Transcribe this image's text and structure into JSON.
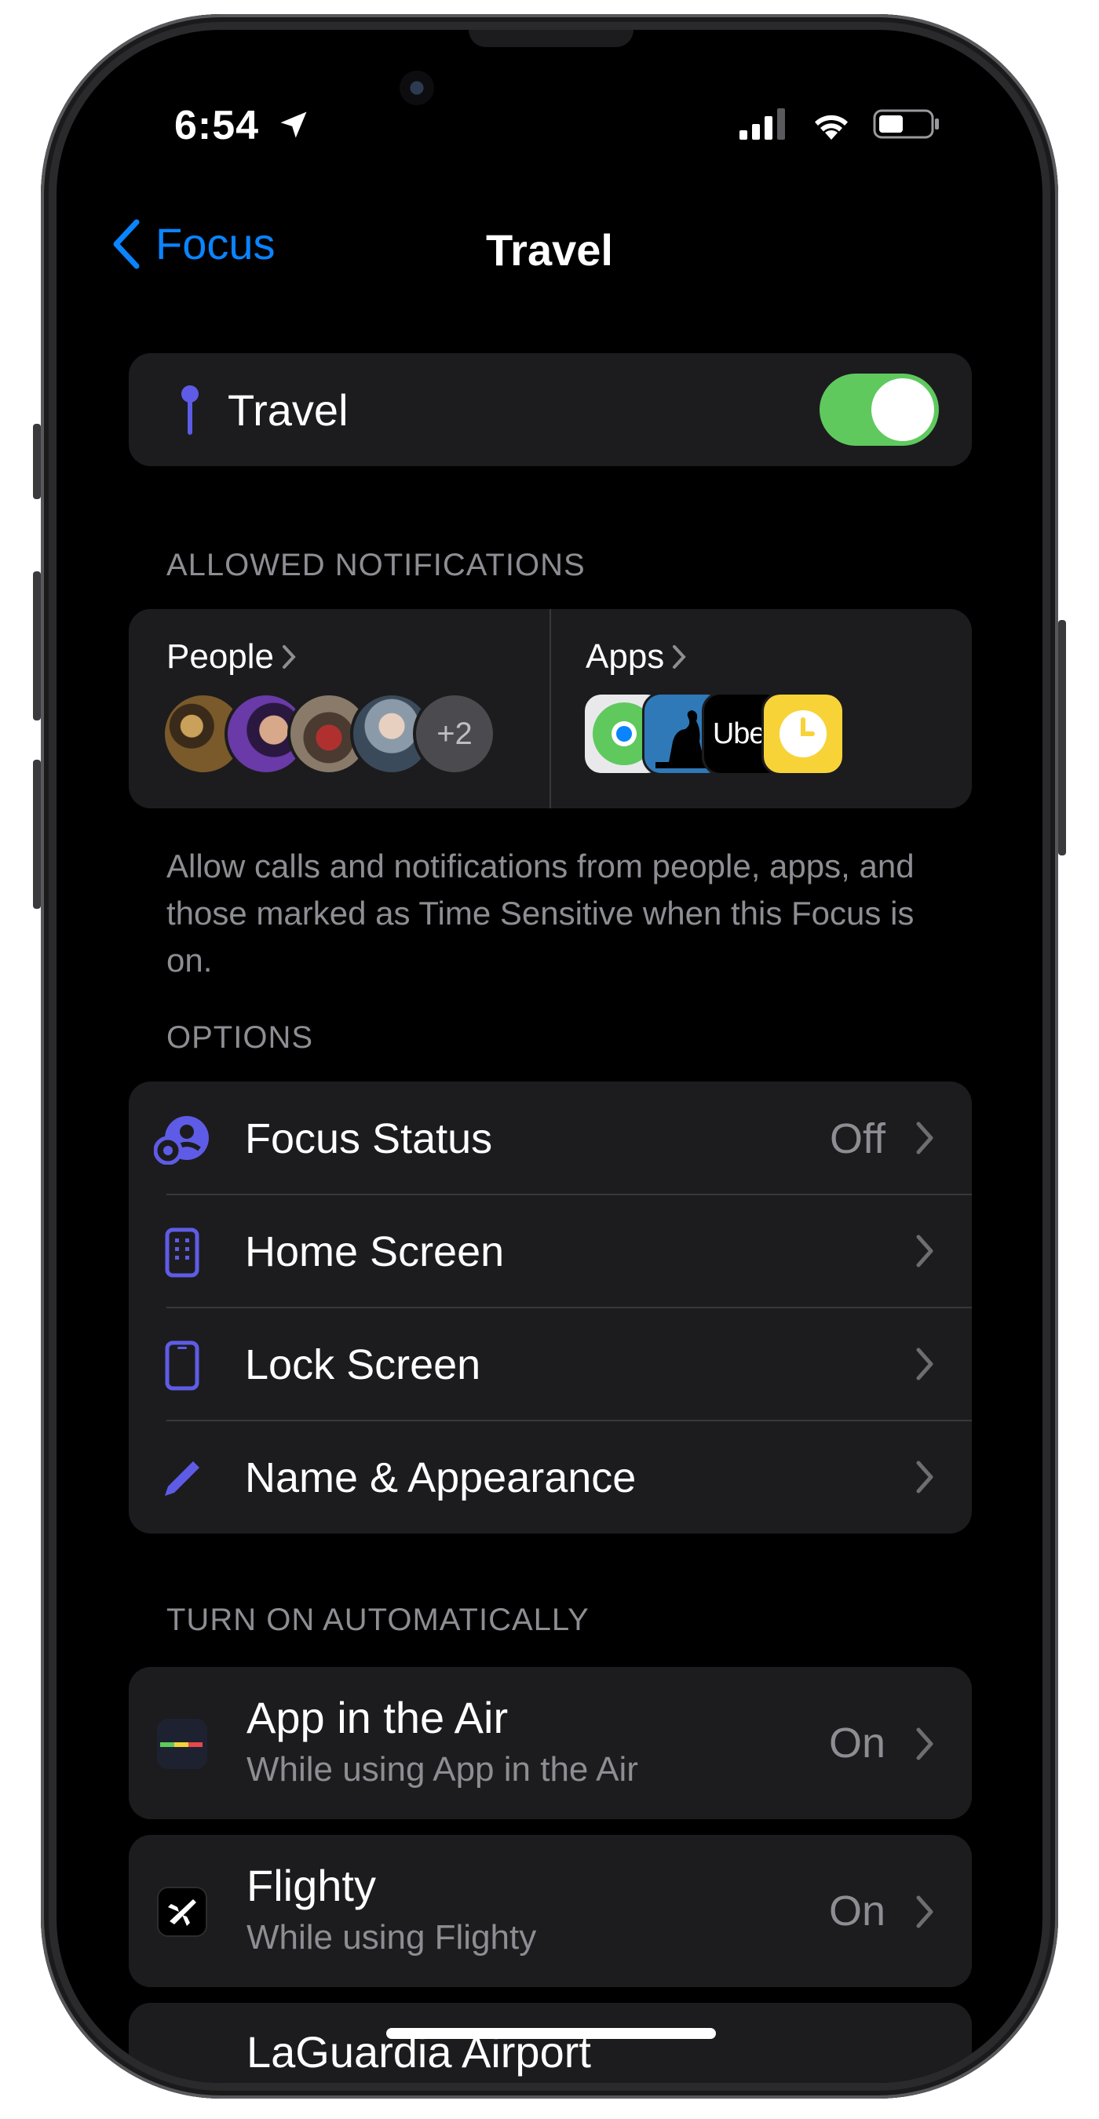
{
  "status_bar": {
    "time": "6:54"
  },
  "nav": {
    "back_label": "Focus",
    "title": "Travel"
  },
  "focus_toggle": {
    "label": "Travel",
    "enabled": true,
    "accent": "#5e5ce6",
    "toggle_color": "#5fc95e"
  },
  "allowed_notifications": {
    "header": "ALLOWED NOTIFICATIONS",
    "people_label": "People",
    "people_more": "+2",
    "apps_label": "Apps",
    "uber_text": "Uber",
    "description": "Allow calls and notifications from people, apps, and those marked as Time Sensitive when this Focus is on."
  },
  "options": {
    "header": "OPTIONS",
    "items": [
      {
        "label": "Focus Status",
        "value": "Off",
        "icon": "focus-status-icon"
      },
      {
        "label": "Home Screen",
        "value": "",
        "icon": "home-screen-icon"
      },
      {
        "label": "Lock Screen",
        "value": "",
        "icon": "lock-screen-icon"
      },
      {
        "label": "Name & Appearance",
        "value": "",
        "icon": "pencil-icon"
      }
    ]
  },
  "automation": {
    "header": "TURN ON AUTOMATICALLY",
    "items": [
      {
        "title": "App in the Air",
        "subtitle": "While using App in the Air",
        "value": "On",
        "icon": "app-in-the-air-icon"
      },
      {
        "title": "Flighty",
        "subtitle": "While using Flighty",
        "value": "On",
        "icon": "flighty-icon"
      },
      {
        "title": "LaGuardia Airport"
      }
    ]
  }
}
